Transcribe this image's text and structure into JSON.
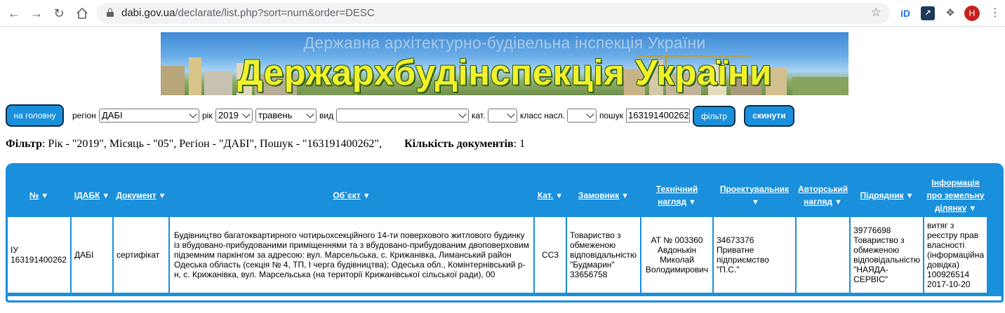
{
  "browser": {
    "url_host": "dabi.gov.ua",
    "url_path": "/declarate/list.php?sort=num&order=DESC",
    "avatar_letter": "H"
  },
  "banner": {
    "subtitle": "Державна архітектурно-будівельна інспекція України",
    "title": "Держархбудінспекція України"
  },
  "filter_bar": {
    "home_button": "на головну",
    "region_label": "регіон",
    "region_value": "ДАБІ",
    "year_label": "рік",
    "year_value": "2019",
    "month_value": "травень",
    "type_label": "вид",
    "type_value": "",
    "category_label": "кат.",
    "category_value": "",
    "class_label": "класс насл.",
    "class_value": "",
    "search_label": "пошук",
    "search_value": "163191400262",
    "filter_button": "фільтр",
    "reset_button": "скинути"
  },
  "summary": {
    "filter_label": "Фільтр",
    "filter_text": ": Рік - \"2019\", Місяць - \"05\", Регіон - \"ДАБІ\", Пошук - \"163191400262\",",
    "count_label": "Кількість документів",
    "count_value": ": 1"
  },
  "table": {
    "headers": [
      "№",
      "ІДАБК",
      "Документ",
      "Об`єкт",
      "Кат.",
      "Замовник",
      "Технічний нагляд",
      "Проектувальник",
      "Авторський нагляд",
      "Підрядник",
      "Інформація про земельну ділянку"
    ],
    "rows": [
      {
        "num": "ІУ 163191400262",
        "idabk": "ДАБІ",
        "document": "сертифікат",
        "object": "Будівництво багатоквартирного чотирьохсекційного 14-ти поверхового житлового будинку із вбудовано-прибудованими приміщеннями та з вбудовано-прибудованим двоповерховим підземним паркінгом за адресою: вул. Марсельська, с. Крижанівка, Лиманський район Одеська область (секція № 4, ТП, І черга будівництва); Одеська обл., Комінтернівський р-н, с. Крижанівка, вул. Марсельська (на території Крижанівської сільської ради), 00",
        "category": "СС3",
        "customer": "Товариство з обмеженою відповідальністю \"Будмарин\" 33656758",
        "tech_supervision": "АТ № 003360 Авдонькін Миколай Володимирович",
        "designer": "34673376 Приватне підприємство \"П.С.\"",
        "author_supervision": "",
        "contractor": "39776698 Товариство з обмеженою відповідальністю \"НАЯДА-СЕРВІС\"",
        "land_info": "витяг з реєстру прав власності (інформаційна довідка) 100926514 2017-10-20"
      }
    ]
  },
  "colors": {
    "accent": "#1a8fdb",
    "banner_title": "#f3f22a"
  }
}
